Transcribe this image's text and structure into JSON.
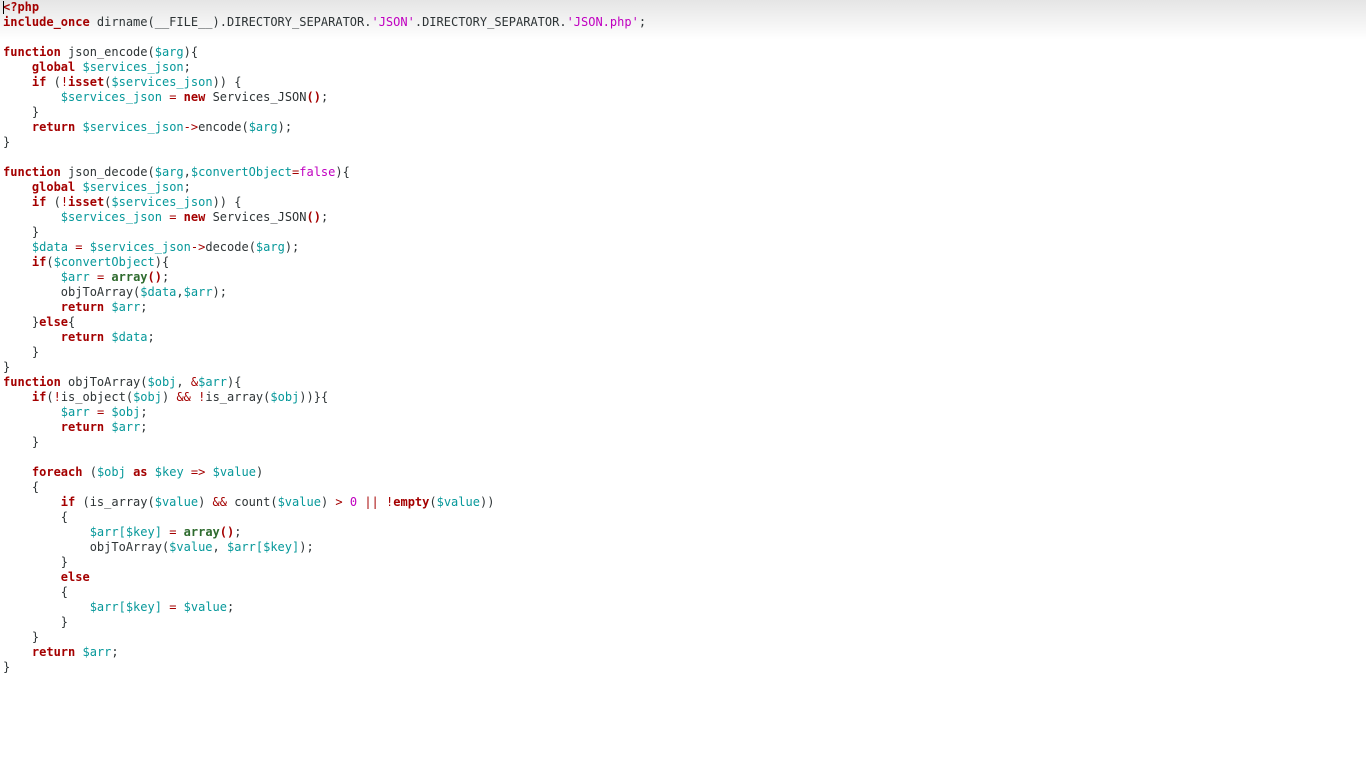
{
  "editor": {
    "language": "php",
    "colors": {
      "background": "#ffffff",
      "default": "#2e3436",
      "keyword": "#a40000",
      "variable": "#06989a",
      "string": "#c000c0",
      "number": "#c000c0",
      "boolean": "#c000c0",
      "operator": "#a40000",
      "builtin": "#2e6b2e"
    },
    "lines": [
      [
        [
          "tag",
          "<?php"
        ]
      ],
      [
        [
          "keyword",
          "include_once"
        ],
        [
          "default",
          " dirname("
        ],
        [
          "default",
          "__FILE__"
        ],
        [
          "default",
          ").DIRECTORY_SEPARATOR."
        ],
        [
          "string",
          "'JSON'"
        ],
        [
          "default",
          ".DIRECTORY_SEPARATOR."
        ],
        [
          "string",
          "'JSON.php'"
        ],
        [
          "default",
          ";"
        ]
      ],
      [],
      [
        [
          "keyword",
          "function"
        ],
        [
          "default",
          " json_encode("
        ],
        [
          "variable",
          "$arg"
        ],
        [
          "default",
          "){"
        ]
      ],
      [
        [
          "default",
          "    "
        ],
        [
          "keyword",
          "global"
        ],
        [
          "default",
          " "
        ],
        [
          "variable",
          "$services_json"
        ],
        [
          "default",
          ";"
        ]
      ],
      [
        [
          "default",
          "    "
        ],
        [
          "keyword",
          "if"
        ],
        [
          "default",
          " ("
        ],
        [
          "operator",
          "!"
        ],
        [
          "keyword",
          "isset"
        ],
        [
          "default",
          "("
        ],
        [
          "variable",
          "$services_json"
        ],
        [
          "default",
          ")) {"
        ]
      ],
      [
        [
          "default",
          "        "
        ],
        [
          "variable",
          "$services_json"
        ],
        [
          "default",
          " "
        ],
        [
          "operator",
          "="
        ],
        [
          "default",
          " "
        ],
        [
          "keyword",
          "new"
        ],
        [
          "default",
          " Services_JSON"
        ],
        [
          "keyword",
          "()"
        ],
        [
          "default",
          ";"
        ]
      ],
      [
        [
          "default",
          "    }"
        ]
      ],
      [
        [
          "default",
          "    "
        ],
        [
          "keyword",
          "return"
        ],
        [
          "default",
          " "
        ],
        [
          "variable",
          "$services_json"
        ],
        [
          "operator",
          "->"
        ],
        [
          "default",
          "encode("
        ],
        [
          "variable",
          "$arg"
        ],
        [
          "default",
          ");"
        ]
      ],
      [
        [
          "default",
          "}"
        ]
      ],
      [],
      [
        [
          "keyword",
          "function"
        ],
        [
          "default",
          " json_decode("
        ],
        [
          "variable",
          "$arg"
        ],
        [
          "default",
          ","
        ],
        [
          "variable",
          "$convertObject"
        ],
        [
          "operator",
          "="
        ],
        [
          "boolean",
          "false"
        ],
        [
          "default",
          "){"
        ]
      ],
      [
        [
          "default",
          "    "
        ],
        [
          "keyword",
          "global"
        ],
        [
          "default",
          " "
        ],
        [
          "variable",
          "$services_json"
        ],
        [
          "default",
          ";"
        ]
      ],
      [
        [
          "default",
          "    "
        ],
        [
          "keyword",
          "if"
        ],
        [
          "default",
          " ("
        ],
        [
          "operator",
          "!"
        ],
        [
          "keyword",
          "isset"
        ],
        [
          "default",
          "("
        ],
        [
          "variable",
          "$services_json"
        ],
        [
          "default",
          ")) {"
        ]
      ],
      [
        [
          "default",
          "        "
        ],
        [
          "variable",
          "$services_json"
        ],
        [
          "default",
          " "
        ],
        [
          "operator",
          "="
        ],
        [
          "default",
          " "
        ],
        [
          "keyword",
          "new"
        ],
        [
          "default",
          " Services_JSON"
        ],
        [
          "keyword",
          "()"
        ],
        [
          "default",
          ";"
        ]
      ],
      [
        [
          "default",
          "    }"
        ]
      ],
      [
        [
          "default",
          "    "
        ],
        [
          "variable",
          "$data"
        ],
        [
          "default",
          " "
        ],
        [
          "operator",
          "="
        ],
        [
          "default",
          " "
        ],
        [
          "variable",
          "$services_json"
        ],
        [
          "operator",
          "->"
        ],
        [
          "default",
          "decode("
        ],
        [
          "variable",
          "$arg"
        ],
        [
          "default",
          ");"
        ]
      ],
      [
        [
          "default",
          "    "
        ],
        [
          "keyword",
          "if"
        ],
        [
          "default",
          "("
        ],
        [
          "variable",
          "$convertObject"
        ],
        [
          "default",
          "){"
        ]
      ],
      [
        [
          "default",
          "        "
        ],
        [
          "variable",
          "$arr"
        ],
        [
          "default",
          " "
        ],
        [
          "operator",
          "="
        ],
        [
          "default",
          " "
        ],
        [
          "builtin",
          "array"
        ],
        [
          "keyword",
          "()"
        ],
        [
          "default",
          ";"
        ]
      ],
      [
        [
          "default",
          "        objToArray("
        ],
        [
          "variable",
          "$data"
        ],
        [
          "default",
          ","
        ],
        [
          "variable",
          "$arr"
        ],
        [
          "default",
          ");"
        ]
      ],
      [
        [
          "default",
          "        "
        ],
        [
          "keyword",
          "return"
        ],
        [
          "default",
          " "
        ],
        [
          "variable",
          "$arr"
        ],
        [
          "default",
          ";"
        ]
      ],
      [
        [
          "default",
          "    }"
        ],
        [
          "keyword",
          "else"
        ],
        [
          "default",
          "{"
        ]
      ],
      [
        [
          "default",
          "        "
        ],
        [
          "keyword",
          "return"
        ],
        [
          "default",
          " "
        ],
        [
          "variable",
          "$data"
        ],
        [
          "default",
          ";"
        ]
      ],
      [
        [
          "default",
          "    }"
        ]
      ],
      [
        [
          "default",
          "}"
        ]
      ],
      [
        [
          "keyword",
          "function"
        ],
        [
          "default",
          " objToArray("
        ],
        [
          "variable",
          "$obj"
        ],
        [
          "default",
          ", "
        ],
        [
          "operator",
          "&"
        ],
        [
          "variable",
          "$arr"
        ],
        [
          "default",
          "){"
        ]
      ],
      [
        [
          "default",
          "    "
        ],
        [
          "keyword",
          "if"
        ],
        [
          "default",
          "("
        ],
        [
          "operator",
          "!"
        ],
        [
          "default",
          "is_object("
        ],
        [
          "variable",
          "$obj"
        ],
        [
          "default",
          ") "
        ],
        [
          "operator",
          "&&"
        ],
        [
          "default",
          " "
        ],
        [
          "operator",
          "!"
        ],
        [
          "default",
          "is_array("
        ],
        [
          "variable",
          "$obj"
        ],
        [
          "default",
          "))}{"
        ]
      ],
      [
        [
          "default",
          "        "
        ],
        [
          "variable",
          "$arr"
        ],
        [
          "default",
          " "
        ],
        [
          "operator",
          "="
        ],
        [
          "default",
          " "
        ],
        [
          "variable",
          "$obj"
        ],
        [
          "default",
          ";"
        ]
      ],
      [
        [
          "default",
          "        "
        ],
        [
          "keyword",
          "return"
        ],
        [
          "default",
          " "
        ],
        [
          "variable",
          "$arr"
        ],
        [
          "default",
          ";"
        ]
      ],
      [
        [
          "default",
          "    }"
        ]
      ],
      [],
      [
        [
          "default",
          "    "
        ],
        [
          "keyword",
          "foreach"
        ],
        [
          "default",
          " ("
        ],
        [
          "variable",
          "$obj"
        ],
        [
          "default",
          " "
        ],
        [
          "keyword",
          "as"
        ],
        [
          "default",
          " "
        ],
        [
          "variable",
          "$key"
        ],
        [
          "default",
          " "
        ],
        [
          "operator",
          "=>"
        ],
        [
          "default",
          " "
        ],
        [
          "variable",
          "$value"
        ],
        [
          "default",
          ")"
        ]
      ],
      [
        [
          "default",
          "    {"
        ]
      ],
      [
        [
          "default",
          "        "
        ],
        [
          "keyword",
          "if"
        ],
        [
          "default",
          " (is_array("
        ],
        [
          "variable",
          "$value"
        ],
        [
          "default",
          ") "
        ],
        [
          "operator",
          "&&"
        ],
        [
          "default",
          " count("
        ],
        [
          "variable",
          "$value"
        ],
        [
          "default",
          ") "
        ],
        [
          "operator",
          ">"
        ],
        [
          "default",
          " "
        ],
        [
          "number",
          "0"
        ],
        [
          "default",
          " "
        ],
        [
          "operator",
          "||"
        ],
        [
          "default",
          " "
        ],
        [
          "operator",
          "!"
        ],
        [
          "keyword",
          "empty"
        ],
        [
          "default",
          "("
        ],
        [
          "variable",
          "$value"
        ],
        [
          "default",
          "))"
        ]
      ],
      [
        [
          "default",
          "        {"
        ]
      ],
      [
        [
          "default",
          "            "
        ],
        [
          "variable",
          "$arr[$key]"
        ],
        [
          "default",
          " "
        ],
        [
          "operator",
          "="
        ],
        [
          "default",
          " "
        ],
        [
          "builtin",
          "array"
        ],
        [
          "keyword",
          "()"
        ],
        [
          "default",
          ";"
        ]
      ],
      [
        [
          "default",
          "            objToArray("
        ],
        [
          "variable",
          "$value"
        ],
        [
          "default",
          ", "
        ],
        [
          "variable",
          "$arr[$key]"
        ],
        [
          "default",
          ");"
        ]
      ],
      [
        [
          "default",
          "        }"
        ]
      ],
      [
        [
          "default",
          "        "
        ],
        [
          "keyword",
          "else"
        ]
      ],
      [
        [
          "default",
          "        {"
        ]
      ],
      [
        [
          "default",
          "            "
        ],
        [
          "variable",
          "$arr[$key]"
        ],
        [
          "default",
          " "
        ],
        [
          "operator",
          "="
        ],
        [
          "default",
          " "
        ],
        [
          "variable",
          "$value"
        ],
        [
          "default",
          ";"
        ]
      ],
      [
        [
          "default",
          "        }"
        ]
      ],
      [
        [
          "default",
          "    }"
        ]
      ],
      [
        [
          "default",
          "    "
        ],
        [
          "keyword",
          "return"
        ],
        [
          "default",
          " "
        ],
        [
          "variable",
          "$arr"
        ],
        [
          "default",
          ";"
        ]
      ],
      [
        [
          "default",
          "}"
        ]
      ]
    ]
  }
}
